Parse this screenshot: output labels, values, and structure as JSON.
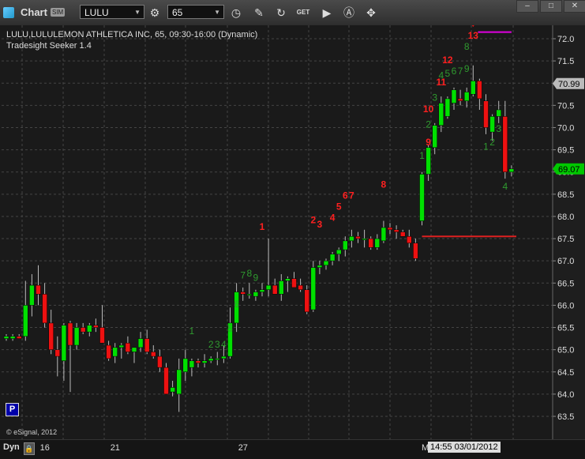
{
  "toolbar": {
    "app_title": "Chart",
    "sim_tag": "SIM",
    "symbol": "LULU",
    "interval": "65",
    "buttons": [
      "settings-icon",
      "clock-icon",
      "draw-icon",
      "refresh-icon",
      "get-icon",
      "play-icon",
      "a-icon",
      "tools-icon"
    ],
    "get_label": "GET"
  },
  "header": {
    "line1": "LULU,LULULEMON ATHLETICA INC, 65, 09:30-16:00 (Dynamic)",
    "line2": "Tradesight Seeker 1.4"
  },
  "footer": {
    "mode": "Dyn",
    "copyright": "© eSignal, 2012",
    "cursor_label": "14:55 03/01/2012",
    "cursor_prefix": "M",
    "x_ticks": [
      {
        "label": "16",
        "bar": 6
      },
      {
        "label": "21",
        "bar": 17
      },
      {
        "label": "27",
        "bar": 37
      }
    ]
  },
  "price_badges": {
    "last_close": "69.07",
    "high_marker": "70.99"
  },
  "colors": {
    "up": "#00e000",
    "down": "#ee1111",
    "count_green": "#2f9a2f",
    "count_red": "#ff2020",
    "grid": "#444444",
    "line_red": "#dd2020",
    "line_magenta": "#e000e0",
    "badge_green": "#00c800",
    "badge_gray": "#bbbbbb"
  },
  "chart_data": {
    "type": "candlestick",
    "ylim": [
      63.25,
      72.3
    ],
    "y_ticks": [
      "63.5",
      "64.0",
      "64.5",
      "65.0",
      "65.5",
      "66.0",
      "66.5",
      "67.0",
      "67.5",
      "68.0",
      "68.5",
      "69.0",
      "69.5",
      "70.0",
      "70.5",
      "71.0",
      "71.5",
      "72.0"
    ],
    "candles": [
      {
        "o": 65.25,
        "h": 65.35,
        "l": 65.2,
        "c": 65.3
      },
      {
        "o": 65.25,
        "h": 65.35,
        "l": 65.2,
        "c": 65.3
      },
      {
        "o": 65.3,
        "h": 65.35,
        "l": 65.25,
        "c": 65.25
      },
      {
        "o": 65.3,
        "h": 66.55,
        "l": 65.2,
        "c": 66.0
      },
      {
        "o": 66.0,
        "h": 66.7,
        "l": 65.75,
        "c": 66.45
      },
      {
        "o": 66.45,
        "h": 66.9,
        "l": 66.0,
        "c": 66.25
      },
      {
        "o": 66.25,
        "h": 66.5,
        "l": 65.5,
        "c": 65.6
      },
      {
        "o": 65.6,
        "h": 65.9,
        "l": 64.9,
        "c": 65.0
      },
      {
        "o": 65.0,
        "h": 65.3,
        "l": 64.4,
        "c": 64.85
      },
      {
        "o": 64.75,
        "h": 65.6,
        "l": 64.3,
        "c": 65.55
      },
      {
        "o": 65.6,
        "h": 65.65,
        "l": 64.05,
        "c": 65.1
      },
      {
        "o": 65.1,
        "h": 65.6,
        "l": 65.0,
        "c": 65.5
      },
      {
        "o": 65.5,
        "h": 65.6,
        "l": 65.35,
        "c": 65.4
      },
      {
        "o": 65.4,
        "h": 65.6,
        "l": 65.3,
        "c": 65.55
      },
      {
        "o": 65.55,
        "h": 65.7,
        "l": 65.4,
        "c": 65.5
      },
      {
        "o": 65.5,
        "h": 66.0,
        "l": 65.3,
        "c": 65.15
      },
      {
        "o": 65.1,
        "h": 65.2,
        "l": 64.75,
        "c": 64.8
      },
      {
        "o": 64.85,
        "h": 65.15,
        "l": 64.7,
        "c": 65.05
      },
      {
        "o": 65.05,
        "h": 65.15,
        "l": 64.8,
        "c": 65.1
      },
      {
        "o": 65.15,
        "h": 65.3,
        "l": 64.9,
        "c": 64.95
      },
      {
        "o": 64.95,
        "h": 65.05,
        "l": 64.7,
        "c": 65.05
      },
      {
        "o": 65.05,
        "h": 65.4,
        "l": 64.95,
        "c": 65.25
      },
      {
        "o": 65.25,
        "h": 65.45,
        "l": 64.9,
        "c": 64.95
      },
      {
        "o": 64.95,
        "h": 65.1,
        "l": 64.8,
        "c": 64.85
      },
      {
        "o": 64.85,
        "h": 65.0,
        "l": 64.5,
        "c": 64.6
      },
      {
        "o": 64.6,
        "h": 64.7,
        "l": 64.0,
        "c": 64.0
      },
      {
        "o": 64.05,
        "h": 64.3,
        "l": 63.95,
        "c": 64.15
      },
      {
        "o": 64.0,
        "h": 64.8,
        "l": 63.6,
        "c": 64.55
      },
      {
        "o": 64.5,
        "h": 65.0,
        "l": 64.3,
        "c": 64.8
      },
      {
        "o": 64.6,
        "h": 64.8,
        "l": 64.4,
        "c": 64.75
      },
      {
        "o": 64.75,
        "h": 64.8,
        "l": 64.6,
        "c": 64.7
      },
      {
        "o": 64.7,
        "h": 64.9,
        "l": 64.6,
        "c": 64.75
      },
      {
        "o": 64.75,
        "h": 64.85,
        "l": 64.7,
        "c": 64.8
      },
      {
        "o": 64.8,
        "h": 64.95,
        "l": 64.65,
        "c": 64.8
      },
      {
        "o": 64.8,
        "h": 65.1,
        "l": 64.7,
        "c": 64.85
      },
      {
        "o": 64.85,
        "h": 65.95,
        "l": 64.8,
        "c": 65.6
      },
      {
        "o": 65.6,
        "h": 66.5,
        "l": 65.4,
        "c": 66.3
      },
      {
        "o": 66.3,
        "h": 66.4,
        "l": 66.1,
        "c": 66.25
      },
      {
        "o": 66.25,
        "h": 66.5,
        "l": 66.15,
        "c": 66.25
      },
      {
        "o": 66.2,
        "h": 66.35,
        "l": 66.1,
        "c": 66.3
      },
      {
        "o": 66.3,
        "h": 66.5,
        "l": 66.2,
        "c": 66.35
      },
      {
        "o": 66.35,
        "h": 67.5,
        "l": 66.2,
        "c": 66.45
      },
      {
        "o": 66.45,
        "h": 66.6,
        "l": 66.25,
        "c": 66.25
      },
      {
        "o": 66.25,
        "h": 66.7,
        "l": 66.1,
        "c": 66.55
      },
      {
        "o": 66.55,
        "h": 66.65,
        "l": 66.3,
        "c": 66.6
      },
      {
        "o": 66.6,
        "h": 66.75,
        "l": 66.45,
        "c": 66.4
      },
      {
        "o": 66.45,
        "h": 66.6,
        "l": 66.3,
        "c": 66.35
      },
      {
        "o": 66.35,
        "h": 66.45,
        "l": 65.8,
        "c": 65.85
      },
      {
        "o": 65.9,
        "h": 67.0,
        "l": 65.85,
        "c": 66.85
      },
      {
        "o": 66.85,
        "h": 67.0,
        "l": 66.7,
        "c": 66.9
      },
      {
        "o": 66.9,
        "h": 67.05,
        "l": 66.8,
        "c": 67.0
      },
      {
        "o": 67.0,
        "h": 67.2,
        "l": 66.9,
        "c": 67.15
      },
      {
        "o": 67.15,
        "h": 67.3,
        "l": 67.0,
        "c": 67.25
      },
      {
        "o": 67.25,
        "h": 67.55,
        "l": 67.1,
        "c": 67.45
      },
      {
        "o": 67.45,
        "h": 67.7,
        "l": 67.3,
        "c": 67.55
      },
      {
        "o": 67.55,
        "h": 67.65,
        "l": 67.4,
        "c": 67.5
      },
      {
        "o": 67.5,
        "h": 67.7,
        "l": 67.3,
        "c": 67.5
      },
      {
        "o": 67.5,
        "h": 67.55,
        "l": 67.25,
        "c": 67.3
      },
      {
        "o": 67.3,
        "h": 67.6,
        "l": 67.25,
        "c": 67.5
      },
      {
        "o": 67.45,
        "h": 67.9,
        "l": 67.4,
        "c": 67.75
      },
      {
        "o": 67.75,
        "h": 67.85,
        "l": 67.6,
        "c": 67.7
      },
      {
        "o": 67.7,
        "h": 67.8,
        "l": 67.5,
        "c": 67.65
      },
      {
        "o": 67.65,
        "h": 67.7,
        "l": 67.55,
        "c": 67.55
      },
      {
        "o": 67.55,
        "h": 67.7,
        "l": 67.3,
        "c": 67.4
      },
      {
        "o": 67.4,
        "h": 67.5,
        "l": 67.0,
        "c": 67.05
      },
      {
        "o": 67.9,
        "h": 69.0,
        "l": 67.8,
        "c": 68.95
      },
      {
        "o": 68.95,
        "h": 69.6,
        "l": 68.8,
        "c": 69.55
      },
      {
        "o": 69.55,
        "h": 70.1,
        "l": 69.4,
        "c": 70.05
      },
      {
        "o": 70.05,
        "h": 70.7,
        "l": 69.9,
        "c": 70.55
      },
      {
        "o": 70.25,
        "h": 70.7,
        "l": 70.2,
        "c": 70.65
      },
      {
        "o": 70.55,
        "h": 70.9,
        "l": 70.4,
        "c": 70.85
      },
      {
        "o": 70.65,
        "h": 70.85,
        "l": 70.5,
        "c": 70.6
      },
      {
        "o": 70.6,
        "h": 70.9,
        "l": 70.45,
        "c": 70.8
      },
      {
        "o": 70.75,
        "h": 71.4,
        "l": 70.7,
        "c": 71.05
      },
      {
        "o": 71.05,
        "h": 71.1,
        "l": 70.4,
        "c": 70.65
      },
      {
        "o": 70.6,
        "h": 70.75,
        "l": 69.85,
        "c": 70.0
      },
      {
        "o": 69.9,
        "h": 70.3,
        "l": 69.7,
        "c": 70.25
      },
      {
        "o": 70.25,
        "h": 70.6,
        "l": 70.1,
        "c": 70.4
      },
      {
        "o": 70.25,
        "h": 70.6,
        "l": 68.85,
        "c": 69.0
      },
      {
        "o": 69.0,
        "h": 69.15,
        "l": 68.9,
        "c": 69.07
      }
    ],
    "counts": [
      {
        "bar": 29,
        "text": "1",
        "color": "green",
        "price": 65.35
      },
      {
        "bar": 32,
        "text": "2",
        "color": "green",
        "price": 65.05
      },
      {
        "bar": 33,
        "text": "3",
        "color": "green",
        "price": 65.05
      },
      {
        "bar": 34,
        "text": "4",
        "color": "green",
        "price": 65.05
      },
      {
        "bar": 35,
        "text": "5",
        "color": "green",
        "price": 65.4
      },
      {
        "bar": 36,
        "text": "6",
        "color": "green",
        "price": 65.95
      },
      {
        "bar": 37,
        "text": "7",
        "color": "green",
        "price": 66.6
      },
      {
        "bar": 38,
        "text": "8",
        "color": "green",
        "price": 66.65
      },
      {
        "bar": 39,
        "text": "9",
        "color": "green",
        "price": 66.55
      },
      {
        "bar": 40,
        "text": "1",
        "color": "red",
        "price": 67.7
      },
      {
        "bar": 48,
        "text": "2",
        "color": "red",
        "price": 67.85
      },
      {
        "bar": 49,
        "text": "3",
        "color": "red",
        "price": 67.75
      },
      {
        "bar": 51,
        "text": "4",
        "color": "red",
        "price": 67.9
      },
      {
        "bar": 52,
        "text": "5",
        "color": "red",
        "price": 68.15
      },
      {
        "bar": 53,
        "text": "6",
        "color": "red",
        "price": 68.4
      },
      {
        "bar": 54,
        "text": "7",
        "color": "red",
        "price": 68.4
      },
      {
        "bar": 59,
        "text": "8",
        "color": "red",
        "price": 68.65
      },
      {
        "bar": 65,
        "text": "1",
        "color": "green",
        "price": 69.3
      },
      {
        "bar": 66,
        "text": "2",
        "color": "green",
        "price": 70.0
      },
      {
        "bar": 66,
        "text": "9",
        "color": "red",
        "price": 69.6
      },
      {
        "bar": 66,
        "text": "10",
        "color": "red",
        "price": 70.35
      },
      {
        "bar": 67,
        "text": "3",
        "color": "green",
        "price": 70.6
      },
      {
        "bar": 68,
        "text": "11",
        "color": "red",
        "price": 70.95
      },
      {
        "bar": 68,
        "text": "4",
        "color": "green",
        "price": 71.1
      },
      {
        "bar": 69,
        "text": "5",
        "color": "green",
        "price": 71.15
      },
      {
        "bar": 70,
        "text": "6",
        "color": "green",
        "price": 71.2
      },
      {
        "bar": 71,
        "text": "7",
        "color": "green",
        "price": 71.2
      },
      {
        "bar": 69,
        "text": "12",
        "color": "red",
        "price": 71.45
      },
      {
        "bar": 72,
        "text": "8",
        "color": "green",
        "price": 71.75
      },
      {
        "bar": 72,
        "text": "9",
        "color": "green",
        "price": 71.25
      },
      {
        "bar": 73,
        "text": "13",
        "color": "red",
        "price": 72.0
      },
      {
        "bar": 75,
        "text": "1",
        "color": "green",
        "price": 69.5
      },
      {
        "bar": 76,
        "text": "2",
        "color": "green",
        "price": 69.6
      },
      {
        "bar": 77,
        "text": "3",
        "color": "green",
        "price": 69.9
      },
      {
        "bar": 78,
        "text": "4",
        "color": "green",
        "price": 68.6
      }
    ],
    "support_line": {
      "price": 67.55,
      "from_bar": 65,
      "to_bar": 80
    },
    "resistance_line": {
      "price": 72.15,
      "from_bar": 74,
      "to_bar": 79
    },
    "arrow_bar": 73,
    "badges": [
      {
        "price": 70.99,
        "label": "70.99",
        "style": "gray"
      },
      {
        "price": 69.07,
        "label": "69.07",
        "style": "green"
      }
    ]
  }
}
